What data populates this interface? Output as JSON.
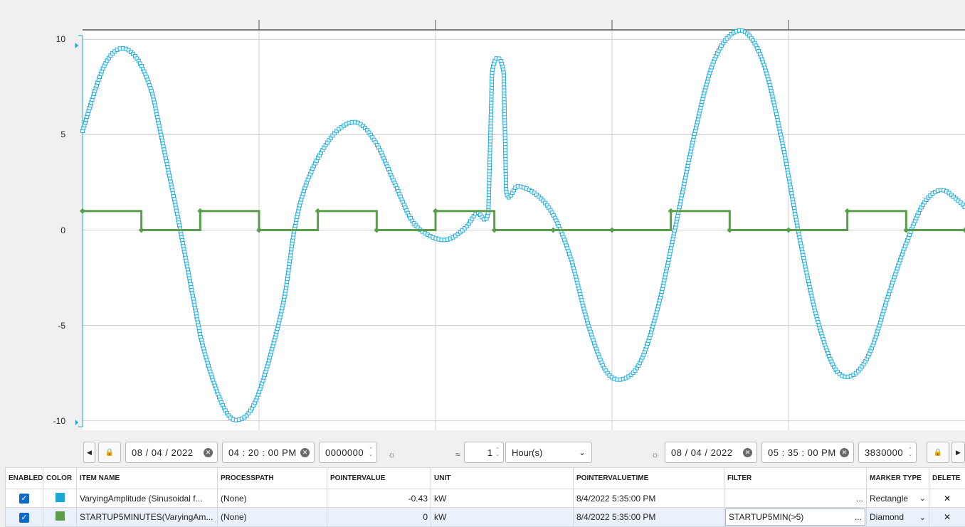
{
  "chart_data": {
    "type": "line",
    "title": "",
    "xlabel": "",
    "ylabel": "",
    "x_range": [
      "08/04/2022 04:20:00 PM",
      "08/04/2022 05:35:00 PM"
    ],
    "x_unit": "minutes",
    "ylim": [
      -10.5,
      10.5
    ],
    "y_ticks": [
      "10",
      "5",
      "0",
      "-5",
      "-10"
    ],
    "grid": true,
    "series": [
      {
        "color": "#1aa8d8",
        "marker": "square",
        "points": [
          [
            0,
            5.2
          ],
          [
            2,
            8.8
          ],
          [
            4,
            9.4
          ],
          [
            6,
            7.0
          ],
          [
            8,
            1.0
          ],
          [
            10,
            -5.5
          ],
          [
            12,
            -9.3
          ],
          [
            13.5,
            -9.9
          ],
          [
            15,
            -8.5
          ],
          [
            17,
            -4.0
          ],
          [
            18,
            0
          ],
          [
            19,
            2.4
          ],
          [
            20.5,
            4.3
          ],
          [
            22,
            5.4
          ],
          [
            23.5,
            5.6
          ],
          [
            25,
            4.5
          ],
          [
            26.5,
            2.5
          ],
          [
            28,
            0.5
          ],
          [
            29.5,
            -0.3
          ],
          [
            31,
            -0.5
          ],
          [
            32.5,
            0.1
          ],
          [
            33.5,
            0.9
          ],
          [
            34.5,
            1.1
          ],
          [
            34.8,
            8.2
          ],
          [
            35.8,
            8.2
          ],
          [
            36,
            2.1
          ],
          [
            37,
            2.3
          ],
          [
            38.5,
            1.9
          ],
          [
            40,
            0.8
          ],
          [
            41.5,
            -1.5
          ],
          [
            43,
            -5.0
          ],
          [
            44.5,
            -7.4
          ],
          [
            46,
            -7.8
          ],
          [
            47.5,
            -6.8
          ],
          [
            49,
            -3.8
          ],
          [
            50.5,
            0.5
          ],
          [
            52,
            5.0
          ],
          [
            53.5,
            8.6
          ],
          [
            55,
            10.2
          ],
          [
            56.5,
            10.3
          ],
          [
            58,
            8.5
          ],
          [
            59.5,
            4.5
          ],
          [
            61,
            -0.6
          ],
          [
            62.5,
            -4.8
          ],
          [
            64,
            -7.3
          ],
          [
            65.5,
            -7.6
          ],
          [
            67,
            -6.3
          ],
          [
            68.5,
            -3.4
          ],
          [
            70,
            -0.7
          ],
          [
            71.5,
            1.4
          ],
          [
            73,
            2.1
          ],
          [
            74.5,
            1.5
          ],
          [
            75,
            1.2
          ]
        ]
      },
      {
        "color": "#5a9e4c",
        "marker": "diamond",
        "step": true,
        "points": [
          [
            0,
            1
          ],
          [
            5,
            0
          ],
          [
            10,
            1
          ],
          [
            15,
            0
          ],
          [
            20,
            1
          ],
          [
            25,
            0
          ],
          [
            30,
            1
          ],
          [
            35,
            0
          ],
          [
            40,
            0
          ],
          [
            45,
            0
          ],
          [
            50,
            1
          ],
          [
            55,
            0
          ],
          [
            60,
            0
          ],
          [
            65,
            1
          ],
          [
            70,
            0
          ],
          [
            75,
            0
          ]
        ]
      }
    ]
  },
  "toolbar": {
    "start_date": "08 / 04 / 2022",
    "start_time": "04 : 20 : 00  PM",
    "start_ms": "0000000",
    "interval_value": "1",
    "interval_unit": "Hour(s)",
    "end_date": "08 / 04 / 2022",
    "end_time": "05 : 35 : 00  PM",
    "end_ms": "3830000",
    "approx_symbol": "≈"
  },
  "icons": {
    "lock": "🔒",
    "left": "◀",
    "right": "▶",
    "sun": "☼",
    "clear": "✕",
    "check": "✓",
    "delete": "✕",
    "chevron": "⌄"
  },
  "table": {
    "headers": [
      "ENABLED",
      "COLOR",
      "ITEM NAME",
      "PROCESSPATH",
      "POINTERVALUE",
      "UNIT",
      "POINTERVALUETIME",
      "FILTER",
      "MARKER TYPE",
      "DELETE"
    ],
    "rows": [
      {
        "color": "#1aa8d8",
        "item_name": "VaryingAmplitude (Sinusoidal f...",
        "processpath": "(None)",
        "pointervalue": "-0.43",
        "unit": "kW",
        "pointervaluetime": "8/4/2022 5:35:00 PM",
        "filter": "",
        "filter_more": "...",
        "marker_type": "Rectangle"
      },
      {
        "color": "#5a9e4c",
        "item_name": "STARTUP5MINUTES(VaryingAm...",
        "processpath": "(None)",
        "pointervalue": "0",
        "unit": "kW",
        "pointervaluetime": "8/4/2022 5:35:00 PM",
        "filter": "STARTUP5MIN(>5)",
        "filter_more": "...",
        "marker_type": "Diamond"
      }
    ]
  }
}
